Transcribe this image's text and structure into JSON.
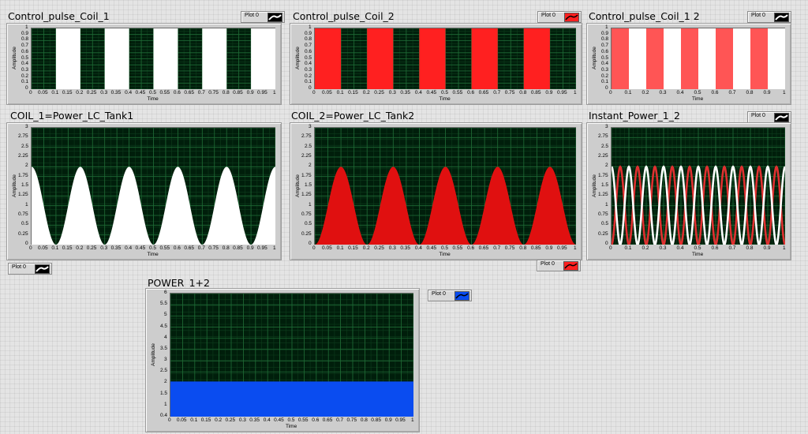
{
  "graphs": [
    {
      "id": "g1",
      "title": "Control_pulse_Coil_1",
      "legend_label": "Plot 0",
      "plot_color": "#ffffff",
      "legend_icon": "white-line-icon",
      "xlabel": "Time",
      "ylabel": "Amplitude",
      "x_ticks": [
        "0",
        "0.05",
        "0.1",
        "0.15",
        "0.2",
        "0.25",
        "0.3",
        "0.35",
        "0.4",
        "0.45",
        "0.5",
        "0.55",
        "0.6",
        "0.65",
        "0.7",
        "0.75",
        "0.8",
        "0.85",
        "0.9",
        "0.95",
        "1"
      ],
      "y_ticks": [
        "0",
        "0.1",
        "0.2",
        "0.3",
        "0.4",
        "0.5",
        "0.6",
        "0.7",
        "0.8",
        "0.9",
        "1"
      ],
      "chart_data": {
        "type": "area",
        "xlim": [
          0,
          1
        ],
        "ylim": [
          0,
          1
        ],
        "series": [
          {
            "kind": "pulse",
            "color": "#ffffff",
            "intervals": [
              [
                0.1,
                0.2
              ],
              [
                0.3,
                0.4
              ],
              [
                0.5,
                0.6
              ],
              [
                0.7,
                0.8
              ],
              [
                0.9,
                1.0
              ]
            ],
            "high": 1
          }
        ]
      }
    },
    {
      "id": "g2",
      "title": "Control_pulse_Coil_2",
      "legend_label": "Plot 0",
      "plot_color": "#ff2020",
      "legend_icon": "red-line-icon",
      "xlabel": "Time",
      "ylabel": "Amplitude",
      "x_ticks": [
        "0",
        "0.05",
        "0.1",
        "0.15",
        "0.2",
        "0.25",
        "0.3",
        "0.35",
        "0.4",
        "0.45",
        "0.5",
        "0.55",
        "0.6",
        "0.65",
        "0.7",
        "0.75",
        "0.8",
        "0.85",
        "0.9",
        "0.95",
        "1"
      ],
      "y_ticks": [
        "0",
        "0.1",
        "0.2",
        "0.3",
        "0.4",
        "0.5",
        "0.6",
        "0.7",
        "0.8",
        "0.9",
        "1"
      ],
      "chart_data": {
        "type": "area",
        "xlim": [
          0,
          1
        ],
        "ylim": [
          0,
          1
        ],
        "series": [
          {
            "kind": "pulse",
            "color": "#ff2020",
            "intervals": [
              [
                0.0,
                0.1
              ],
              [
                0.2,
                0.3
              ],
              [
                0.4,
                0.5
              ],
              [
                0.6,
                0.7
              ],
              [
                0.8,
                0.9
              ]
            ],
            "high": 1
          }
        ]
      }
    },
    {
      "id": "g3",
      "title": "Control_pulse_Coil_1 2",
      "legend_label": "Plot 0",
      "plot_color": "#ffffff",
      "legend_icon": "white-line-icon",
      "xlabel": "Time",
      "ylabel": "Amplitude",
      "x_ticks": [
        "0",
        "0.1",
        "0.2",
        "0.3",
        "0.4",
        "0.5",
        "0.6",
        "0.7",
        "0.8",
        "0.9",
        "1"
      ],
      "y_ticks": [
        "0",
        "0.1",
        "0.2",
        "0.3",
        "0.4",
        "0.5",
        "0.6",
        "0.7",
        "0.8",
        "0.9",
        "1"
      ],
      "chart_data": {
        "type": "area",
        "xlim": [
          0,
          1
        ],
        "ylim": [
          0,
          1
        ],
        "series": [
          {
            "kind": "pulse",
            "color": "#ff5555",
            "intervals": [
              [
                0.0,
                0.1
              ],
              [
                0.2,
                0.3
              ],
              [
                0.4,
                0.5
              ],
              [
                0.6,
                0.7
              ],
              [
                0.8,
                0.9
              ]
            ],
            "high": 1
          },
          {
            "kind": "pulse",
            "color": "#ffffff",
            "intervals": [
              [
                0.1,
                0.2
              ],
              [
                0.3,
                0.4
              ],
              [
                0.5,
                0.6
              ],
              [
                0.7,
                0.8
              ],
              [
                0.9,
                1.0
              ]
            ],
            "high": 1
          }
        ]
      }
    },
    {
      "id": "g4",
      "title": "COIL_1=Power_LC_Tank1",
      "legend_label": "Plot 0",
      "plot_color": "#ffffff",
      "legend_icon": "white-line-icon",
      "xlabel": "Time",
      "ylabel": "Amplitude",
      "x_ticks": [
        "0",
        "0.05",
        "0.1",
        "0.15",
        "0.2",
        "0.25",
        "0.3",
        "0.35",
        "0.4",
        "0.45",
        "0.5",
        "0.55",
        "0.6",
        "0.65",
        "0.7",
        "0.75",
        "0.8",
        "0.85",
        "0.9",
        "0.95",
        "1"
      ],
      "y_ticks": [
        "0",
        "0.25",
        "0.5",
        "0.75",
        "1",
        "1.25",
        "1.5",
        "1.75",
        "2",
        "2.25",
        "2.5",
        "2.75",
        "3"
      ],
      "chart_data": {
        "type": "area",
        "xlim": [
          0,
          1
        ],
        "ylim": [
          0,
          3
        ],
        "series": [
          {
            "kind": "sine",
            "color": "#ffffff",
            "offset": 1,
            "amplitude": 1,
            "period": 0.2,
            "phase_cos": true,
            "fill": true
          }
        ]
      }
    },
    {
      "id": "g5",
      "title": "COIL_2=Power_LC_Tank2",
      "legend_label": "Plot 0",
      "plot_color": "#ff1a1a",
      "legend_icon": "red-line-icon",
      "xlabel": "Time",
      "ylabel": "Amplitude",
      "x_ticks": [
        "0",
        "0.05",
        "0.1",
        "0.15",
        "0.2",
        "0.25",
        "0.3",
        "0.35",
        "0.4",
        "0.45",
        "0.5",
        "0.55",
        "0.6",
        "0.65",
        "0.7",
        "0.75",
        "0.8",
        "0.85",
        "0.9",
        "0.95",
        "1"
      ],
      "y_ticks": [
        "0",
        "0.25",
        "0.5",
        "0.75",
        "1",
        "1.25",
        "1.5",
        "1.75",
        "2",
        "2.25",
        "2.5",
        "2.75",
        "3"
      ],
      "chart_data": {
        "type": "area",
        "xlim": [
          0,
          1
        ],
        "ylim": [
          0,
          3
        ],
        "series": [
          {
            "kind": "sine",
            "color": "#e01010",
            "offset": 1,
            "amplitude": -1,
            "period": 0.2,
            "phase_cos": true,
            "fill": true
          }
        ]
      }
    },
    {
      "id": "g6",
      "title": "Instant_Power_1_2",
      "legend_label": "Plot 0",
      "plot_color": "#ffffff",
      "legend_icon": "white-line-icon",
      "xlabel": "Time",
      "ylabel": "Amplitude",
      "x_ticks": [
        "0",
        "0.1",
        "0.2",
        "0.3",
        "0.4",
        "0.5",
        "0.6",
        "0.7",
        "0.8",
        "0.9",
        "1"
      ],
      "y_ticks": [
        "0",
        "0.25",
        "0.5",
        "0.75",
        "1",
        "1.25",
        "1.5",
        "1.75",
        "2",
        "2.25",
        "2.5",
        "2.75",
        "3"
      ],
      "chart_data": {
        "type": "line",
        "xlim": [
          0,
          1
        ],
        "ylim": [
          0,
          3
        ],
        "series": [
          {
            "kind": "sine",
            "color": "#e03030",
            "offset": 1,
            "amplitude": -1,
            "period": 0.1,
            "phase_cos": true,
            "fill": false
          },
          {
            "kind": "sine",
            "color": "#ffffff",
            "offset": 1,
            "amplitude": 1,
            "period": 0.1,
            "phase_cos": true,
            "fill": false
          }
        ]
      }
    },
    {
      "id": "g7",
      "title": "POWER_1+2",
      "legend_label": "Plot 0",
      "plot_color": "#0a4cf0",
      "legend_icon": "blue-line-icon",
      "xlabel": "Time",
      "ylabel": "Amplitude",
      "x_ticks": [
        "0",
        "0.05",
        "0.1",
        "0.15",
        "0.2",
        "0.25",
        "0.3",
        "0.35",
        "0.4",
        "0.45",
        "0.5",
        "0.55",
        "0.6",
        "0.65",
        "0.7",
        "0.75",
        "0.8",
        "0.85",
        "0.9",
        "0.95",
        "1"
      ],
      "y_ticks": [
        "0.4",
        "1",
        "1.5",
        "2",
        "2.5",
        "3",
        "3.5",
        "4",
        "4.5",
        "5",
        "5.5",
        "6"
      ],
      "chart_data": {
        "type": "area",
        "xlim": [
          0,
          1
        ],
        "ylim": [
          0.4,
          6
        ],
        "series": [
          {
            "kind": "constant",
            "color": "#0a4cf0",
            "value": 2,
            "fill": true
          }
        ]
      }
    }
  ]
}
